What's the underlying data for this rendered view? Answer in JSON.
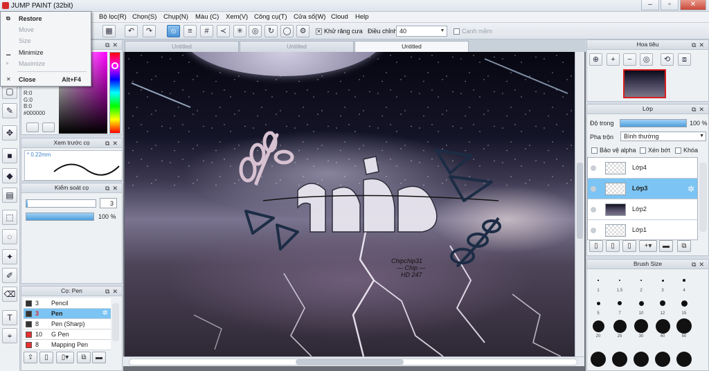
{
  "window": {
    "title": "JUMP PAINT (32bit)"
  },
  "menu": [
    "Bộ lọc(R)",
    "Chọn(S)",
    "Chụp(N)",
    "Màu (C)",
    "Xem(V)",
    "Công cụ(T)",
    "Cửa sổ(W)",
    "Cloud",
    "Help"
  ],
  "context_menu": {
    "restore": "Restore",
    "move": "Move",
    "size": "Size",
    "minimize": "Minimize",
    "maximize": "Maximize",
    "close": "Close",
    "close_accel": "Alt+F4"
  },
  "toolbar": {
    "antialias_label": "Khử răng cưa",
    "adjust_label": "Điều chỉnh",
    "adjust_value": "40",
    "canh_mem_label": "Canh mềm"
  },
  "tabs": [
    "Untitled",
    "Untitled",
    "Untitled"
  ],
  "color_panel": {
    "r": "R:0",
    "g": "G:0",
    "b": "B:0",
    "hex": "#000000"
  },
  "brush_preview": {
    "title": "Xem trước cọ",
    "size": "0.22mm"
  },
  "brush_control": {
    "title": "Kiểm soát cọ",
    "size_value": "3",
    "opacity_pct": 100,
    "opacity_label": "100 %"
  },
  "brush_list": {
    "title": "Cọ: Pen",
    "items": [
      {
        "size": "3",
        "name": "Pencil",
        "color": "#333333"
      },
      {
        "size": "3",
        "name": "Pen",
        "color": "#333333",
        "selected": true
      },
      {
        "size": "8",
        "name": "Pen (Sharp)",
        "color": "#333333"
      },
      {
        "size": "10",
        "name": "G Pen",
        "color": "#e83030"
      },
      {
        "size": "8",
        "name": "Mapping Pen",
        "color": "#e83030"
      }
    ]
  },
  "navigator": {
    "title": "Hoa tiêu"
  },
  "layers": {
    "title": "Lớp",
    "opacity_label": "Độ trong",
    "opacity_pct": 100,
    "opacity_value": "100 %",
    "blend_label": "Pha trộn",
    "blend_value": "Bình thường",
    "protect_alpha": "Bảo vệ alpha",
    "clipping": "Xén bớt",
    "lock": "Khóa",
    "items": [
      {
        "name": "Lớp4",
        "thumb": "transparent"
      },
      {
        "name": "Lớp3",
        "thumb": "transparent",
        "selected": true
      },
      {
        "name": "Lớp2",
        "thumb": "image"
      },
      {
        "name": "Lớp1",
        "thumb": "transparent"
      }
    ]
  },
  "brush_size": {
    "title": "Brush Size",
    "labels": [
      "1",
      "1.5",
      "2",
      "3",
      "4",
      "5",
      "7",
      "10",
      "12",
      "15",
      "20",
      "25",
      "30",
      "40",
      "50"
    ]
  },
  "artwork": {
    "signature_line1": "Chipchip31",
    "signature_line2": "— Chip —",
    "signature_line3": "HD 247"
  }
}
